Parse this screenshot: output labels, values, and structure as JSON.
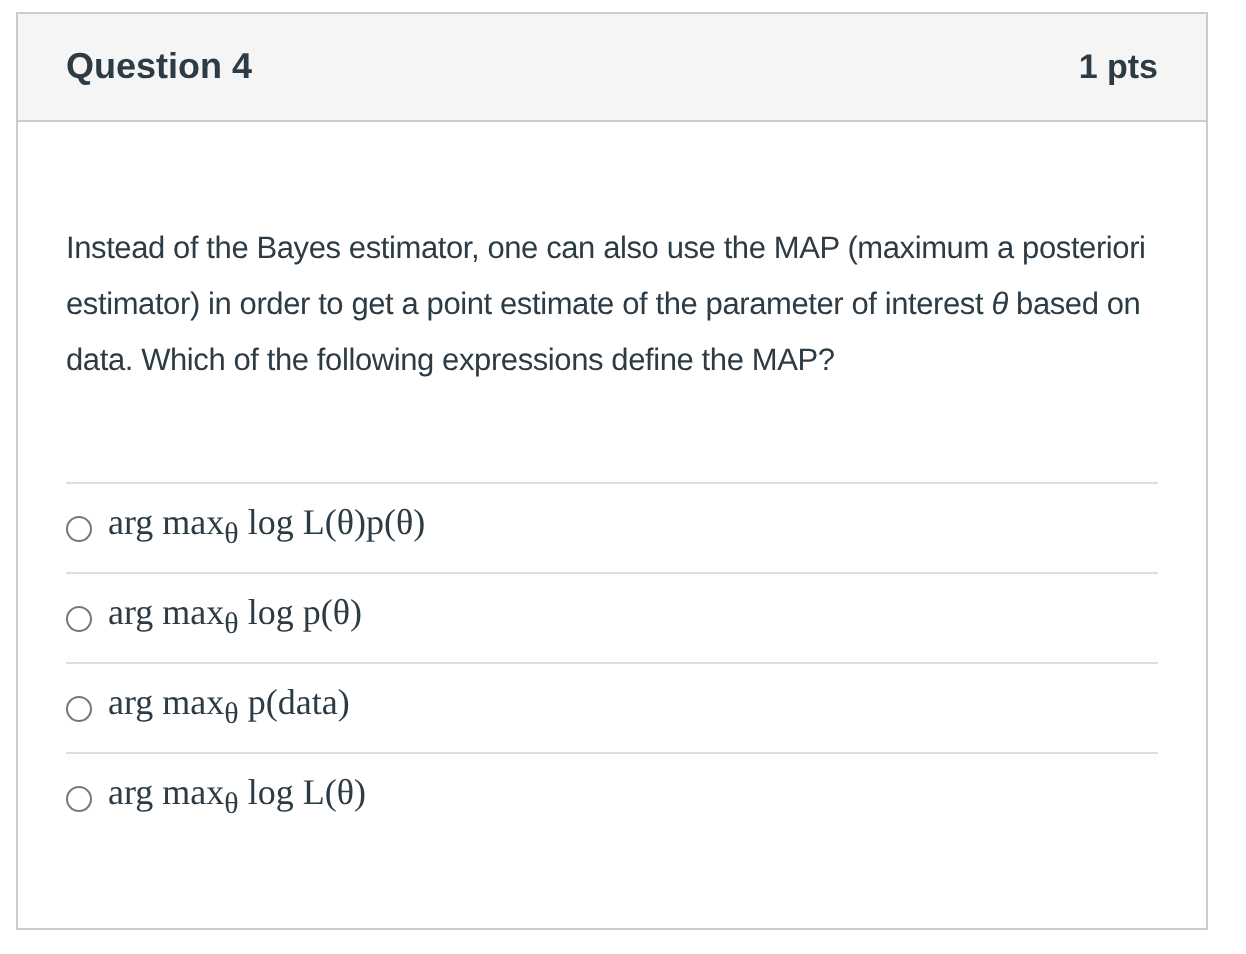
{
  "question": {
    "title": "Question 4",
    "points": "1 pts",
    "text": "Instead of the Bayes estimator, one can also use the MAP (maximum a posteriori estimator) in order to get a point estimate of the parameter of interest *θ* based on data. Which of the following expressions define the MAP?"
  },
  "answers": [
    {
      "label": "arg max$_{θ}$ log L(θ)p(θ)",
      "selected": false
    },
    {
      "label": "arg max$_{θ}$ log p(θ)",
      "selected": false
    },
    {
      "label": "arg max$_{θ}$ p(data)",
      "selected": false
    },
    {
      "label": "arg max$_{θ}$ log L(θ)",
      "selected": false
    }
  ]
}
